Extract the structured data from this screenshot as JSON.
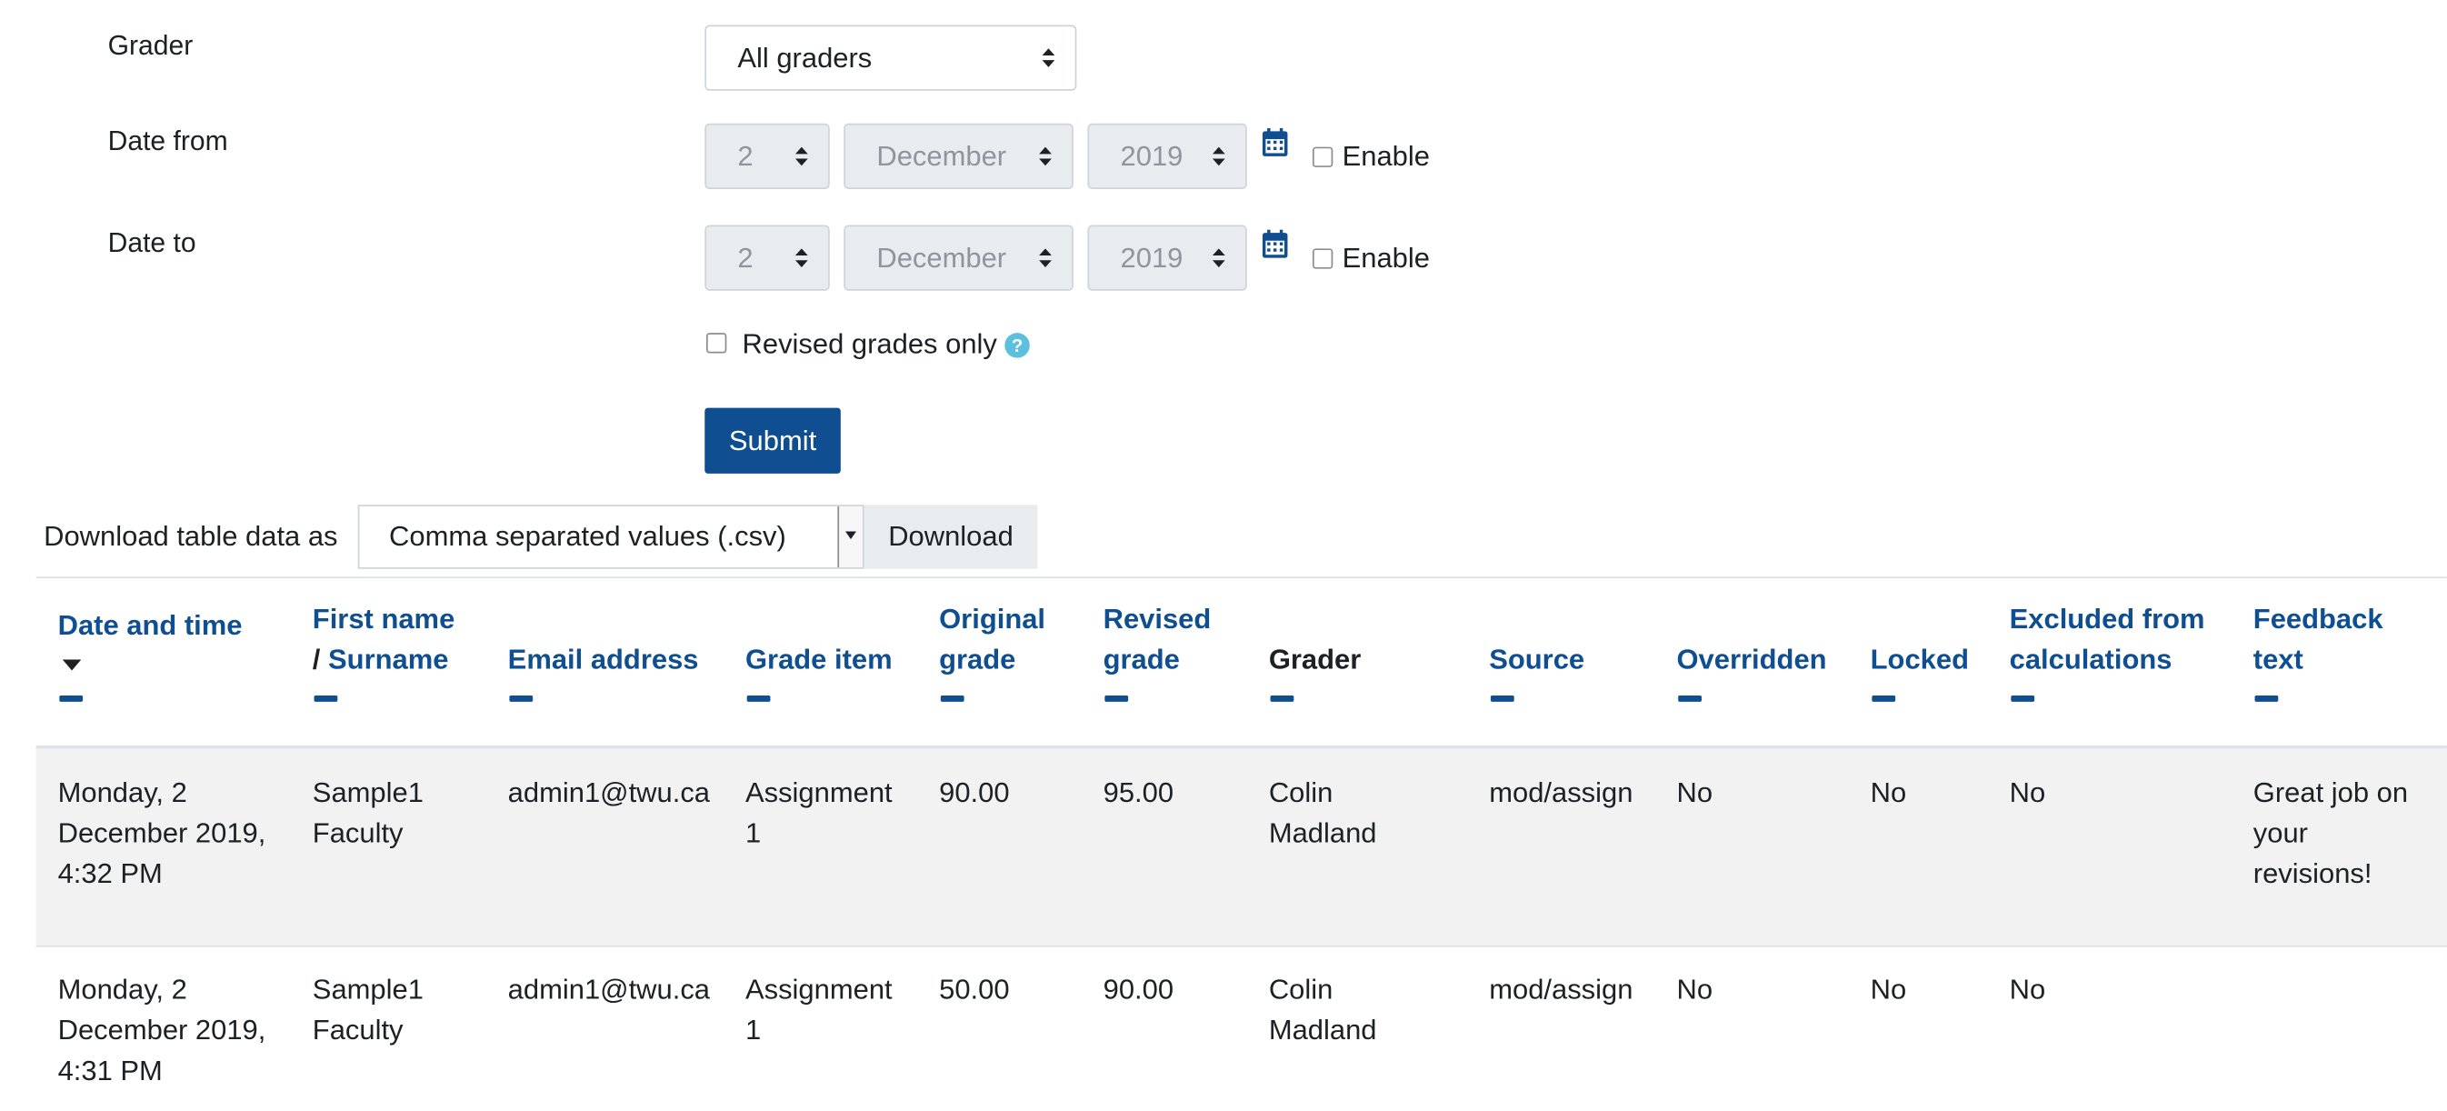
{
  "filters": {
    "grader_label": "Grader",
    "grader_value": "All graders",
    "date_from_label": "Date from",
    "date_from": {
      "day": "2",
      "month": "December",
      "year": "2019",
      "enable_label": "Enable"
    },
    "date_to_label": "Date to",
    "date_to": {
      "day": "2",
      "month": "December",
      "year": "2019",
      "enable_label": "Enable"
    },
    "revised_only_label": "Revised grades only",
    "help_icon": "?",
    "submit_label": "Submit"
  },
  "download": {
    "label": "Download table data as",
    "format": "Comma separated values (.csv)",
    "button_label": "Download"
  },
  "table": {
    "headers": {
      "datetime": "Date and time",
      "name_first": "First name",
      "name_sep": "/",
      "name_surname": "Surname",
      "email": "Email address",
      "grade_item": "Grade item",
      "original_1": "Original",
      "original_2": "grade",
      "revised_1": "Revised",
      "revised_2": "grade",
      "grader": "Grader",
      "source": "Source",
      "overridden": "Overridden",
      "locked": "Locked",
      "excluded_1": "Excluded from",
      "excluded_2": "calculations",
      "feedback_1": "Feedback",
      "feedback_2": "text"
    },
    "rows": [
      {
        "datetime": [
          "Monday, 2",
          "December 2019,",
          "4:32 PM"
        ],
        "name": [
          "Sample1",
          "Faculty"
        ],
        "email": "admin1@twu.ca",
        "grade_item": [
          "Assignment",
          "1"
        ],
        "original": "90.00",
        "revised": "95.00",
        "grader": [
          "Colin",
          "Madland"
        ],
        "source": "mod/assign",
        "overridden": "No",
        "locked": "No",
        "excluded": "No",
        "feedback": [
          "Great job on",
          "your",
          "revisions!"
        ]
      },
      {
        "datetime": [
          "Monday, 2",
          "December 2019,",
          "4:31 PM"
        ],
        "name": [
          "Sample1",
          "Faculty"
        ],
        "email": "admin1@twu.ca",
        "grade_item": [
          "Assignment",
          "1"
        ],
        "original": "50.00",
        "revised": "90.00",
        "grader": [
          "Colin",
          "Madland"
        ],
        "source": "mod/assign",
        "overridden": "No",
        "locked": "No",
        "excluded": "No",
        "feedback": []
      }
    ]
  },
  "icons": {
    "select_caret": "up-down-caret-icon",
    "calendar": "calendar-icon",
    "sort": "sort-desc-icon",
    "collapse": "collapse-column-icon"
  },
  "colors": {
    "link": "#0f4f91",
    "primary_button": "#0f4f91",
    "help_icon": "#5bc0de",
    "disabled_field": "#e9ecef",
    "row_stripe": "#f2f2f2"
  }
}
